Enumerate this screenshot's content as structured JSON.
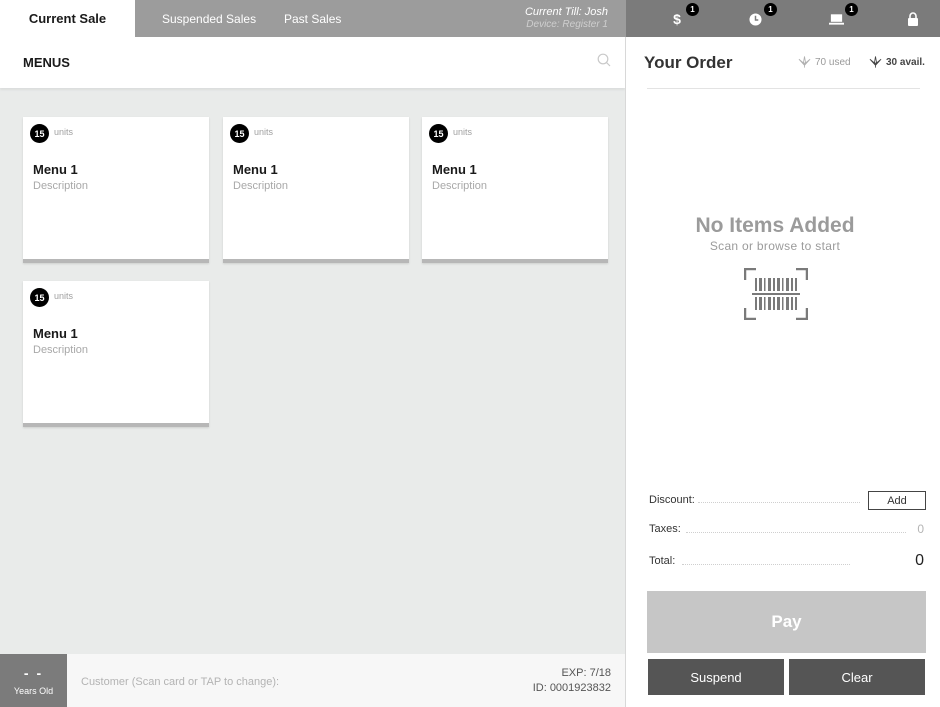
{
  "topbar": {
    "tabs": [
      {
        "label": "Current Sale",
        "active": true
      },
      {
        "label": "Suspended Sales",
        "active": false
      },
      {
        "label": "Past Sales",
        "active": false
      }
    ],
    "till_label": "Current Till: Josh",
    "device_label": "Device: Register 1",
    "icons": [
      {
        "name": "dollar-icon",
        "glyph": "$",
        "badge": "1"
      },
      {
        "name": "clock-icon",
        "glyph": "clock",
        "badge": "1"
      },
      {
        "name": "laptop-icon",
        "glyph": "laptop",
        "badge": "1"
      },
      {
        "name": "lock-icon",
        "glyph": "lock",
        "badge": null
      }
    ]
  },
  "menus": {
    "title": "MENUS",
    "cards": [
      {
        "count": "15",
        "units": "units",
        "title": "Menu 1",
        "description": "Description"
      },
      {
        "count": "15",
        "units": "units",
        "title": "Menu 1",
        "description": "Description"
      },
      {
        "count": "15",
        "units": "units",
        "title": "Menu 1",
        "description": "Description"
      },
      {
        "count": "15",
        "units": "units",
        "title": "Menu 1",
        "description": "Description"
      }
    ]
  },
  "customer": {
    "age_value": "- -",
    "age_label": "Years Old",
    "placeholder": "Customer (Scan card or TAP to change):",
    "exp": "EXP: 7/18",
    "id": "ID: 0001923832"
  },
  "order": {
    "title": "Your Order",
    "used": "70 used",
    "available": "30 avail.",
    "empty_title": "No Items Added",
    "empty_subtitle": "Scan or browse to start",
    "discount_label": "Discount:",
    "add_label": "Add",
    "taxes_label": "Taxes:",
    "taxes_value": "0",
    "total_label": "Total:",
    "total_value": "0",
    "pay_label": "Pay",
    "suspend_label": "Suspend",
    "clear_label": "Clear"
  },
  "colors": {
    "topbar": "#9c9c9c",
    "icon_bar": "#7b7b7b",
    "background": "#e9ebea",
    "pay_disabled": "#c6c6c6",
    "action_button": "#555555"
  }
}
